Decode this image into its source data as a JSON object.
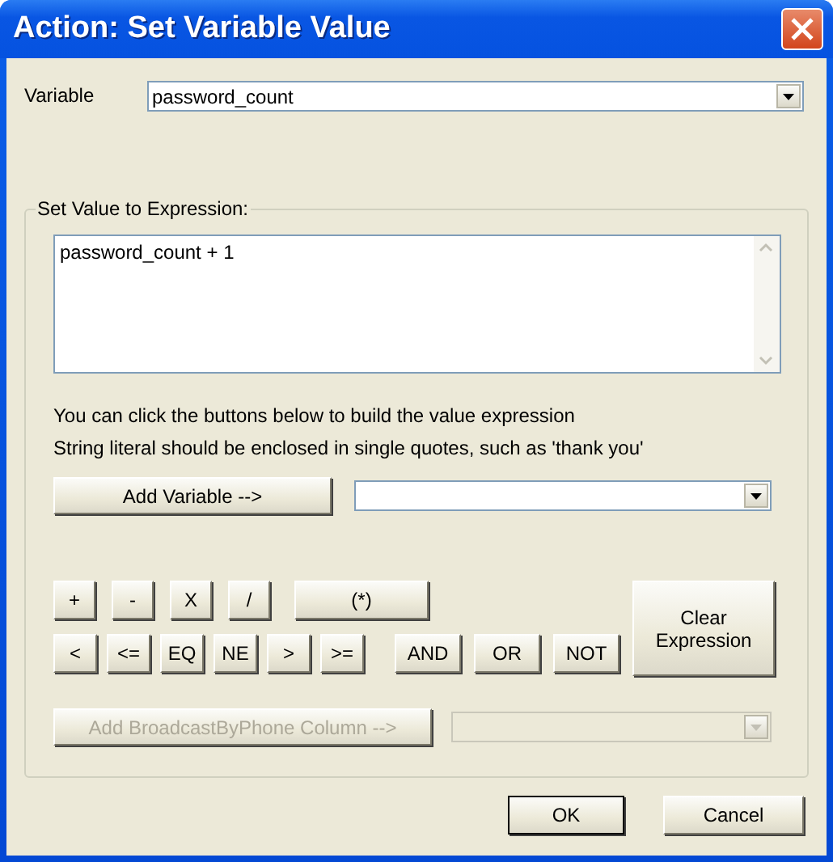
{
  "window": {
    "title": "Action: Set Variable Value"
  },
  "variable": {
    "label": "Variable",
    "value": "password_count"
  },
  "group": {
    "legend": "Set Value to Expression:",
    "expression": "password_count + 1",
    "help_lines": [
      "You can click the buttons below to build the value expression",
      "String literal should be enclosed in single quotes, such as 'thank you'"
    ],
    "add_variable": {
      "label": "Add Variable -->",
      "disabled": false
    },
    "operator_rows": [
      [
        {
          "label": "+",
          "kind": "arith"
        },
        {
          "label": "-",
          "kind": "arith"
        },
        {
          "label": "X",
          "kind": "arith"
        },
        {
          "label": "/",
          "kind": "arith"
        },
        {
          "label": "(*)",
          "kind": "group"
        }
      ],
      [
        {
          "label": "<",
          "kind": "compare"
        },
        {
          "label": "<=",
          "kind": "compare"
        },
        {
          "label": "EQ",
          "kind": "compare"
        },
        {
          "label": "NE",
          "kind": "compare"
        },
        {
          "label": ">",
          "kind": "compare"
        },
        {
          "label": ">=",
          "kind": "compare"
        },
        {
          "label": "AND",
          "kind": "logic"
        },
        {
          "label": "OR",
          "kind": "logic"
        },
        {
          "label": "NOT",
          "kind": "logic"
        }
      ]
    ],
    "clear": {
      "label": "Clear Expression"
    },
    "add_column": {
      "label": "Add BroadcastByPhone Column -->",
      "disabled": true
    }
  },
  "buttons": [
    {
      "label": "OK",
      "default": true
    },
    {
      "label": "Cancel",
      "default": false
    }
  ]
}
